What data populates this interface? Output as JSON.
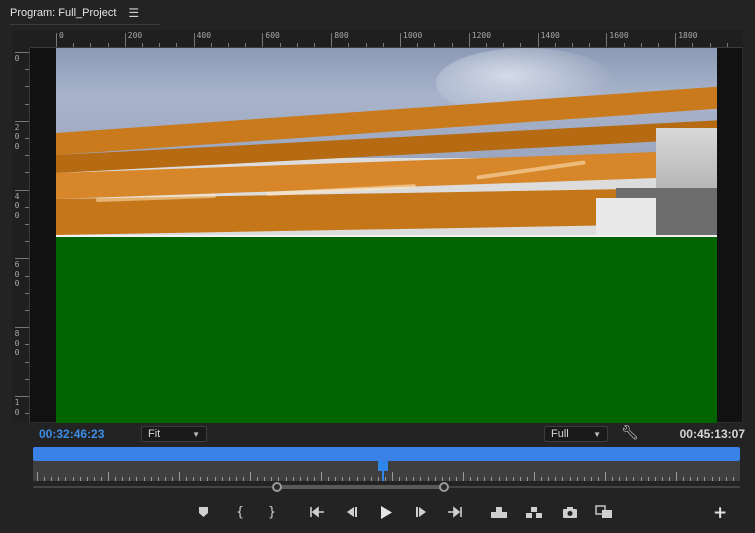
{
  "panel": {
    "title": "Program: Full_Project",
    "menu_icon": "hamburger-menu-icon"
  },
  "ruler": {
    "top_labels": [
      "0",
      "200",
      "400",
      "600",
      "800",
      "1000",
      "1200",
      "1400",
      "1600",
      "1800"
    ],
    "left_labels": [
      "0",
      "200",
      "400",
      "600",
      "800",
      "10"
    ]
  },
  "controls": {
    "current_timecode": "00:32:46:23",
    "fit_label": "Fit",
    "resolution_label": "Full",
    "duration_timecode": "00:45:13:07",
    "settings_icon": "wrench-icon"
  },
  "transport": {
    "buttons": [
      {
        "name": "add-marker-button",
        "icon": "marker-icon"
      },
      {
        "name": "mark-in-button",
        "icon": "mark-in-icon"
      },
      {
        "name": "mark-out-button",
        "icon": "mark-out-icon"
      },
      {
        "name": "go-to-in-button",
        "icon": "go-to-in-icon"
      },
      {
        "name": "step-back-button",
        "icon": "step-back-icon"
      },
      {
        "name": "play-button",
        "icon": "play-icon"
      },
      {
        "name": "step-forward-button",
        "icon": "step-forward-icon"
      },
      {
        "name": "go-to-out-button",
        "icon": "go-to-out-icon"
      },
      {
        "name": "lift-button",
        "icon": "lift-icon"
      },
      {
        "name": "extract-button",
        "icon": "extract-icon"
      },
      {
        "name": "export-frame-button",
        "icon": "camera-icon"
      },
      {
        "name": "comparison-view-button",
        "icon": "comparison-icon"
      }
    ],
    "add_button": "+"
  },
  "colors": {
    "accent": "#3b8fe8",
    "green_screen": "#006400"
  }
}
